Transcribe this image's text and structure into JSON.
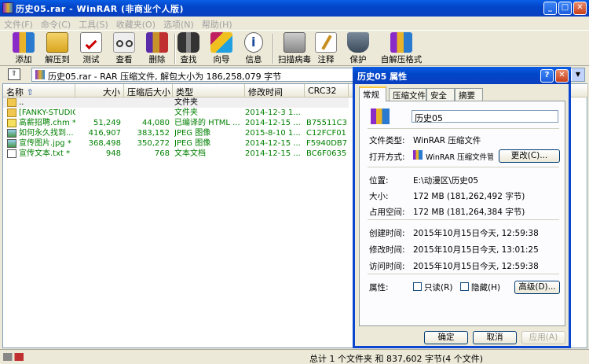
{
  "window": {
    "title": "历史05.rar - WinRAR (非商业个人版)",
    "min": "_",
    "max": "□",
    "close": "✕"
  },
  "menu": [
    "文件(F)",
    "命令(C)",
    "工具(S)",
    "收藏夹(O)",
    "选项(N)",
    "帮助(H)"
  ],
  "toolbar": [
    {
      "label": "添加",
      "icon": "add-books-icon"
    },
    {
      "label": "解压到",
      "icon": "extract-folder-icon"
    },
    {
      "label": "测试",
      "icon": "test-clipboard-icon"
    },
    {
      "label": "查看",
      "icon": "view-glasses-icon"
    },
    {
      "label": "删除",
      "icon": "delete-box-icon"
    },
    {
      "label": "查找",
      "icon": "find-binoculars-icon"
    },
    {
      "label": "向导",
      "icon": "wizard-wand-icon"
    },
    {
      "label": "信息",
      "icon": "info-icon"
    },
    {
      "label": "扫描病毒",
      "icon": "virus-scan-icon"
    },
    {
      "label": "注释",
      "icon": "comment-pen-icon"
    },
    {
      "label": "保护",
      "icon": "shield-icon"
    },
    {
      "label": "自解压格式",
      "icon": "sfx-books-icon"
    }
  ],
  "address": {
    "text": "历史05.rar - RAR 压缩文件, 解包大小为 186,258,079 字节",
    "up": "⇧",
    "drop": "▼"
  },
  "columns": {
    "name": "名称",
    "size": "大小",
    "packed": "压缩后大小",
    "type": "类型",
    "modified": "修改时间",
    "crc": "CRC32",
    "sort_arrow": "⇧"
  },
  "files": [
    {
      "name": "..",
      "size": "",
      "packed": "",
      "type": "文件夹",
      "modified": "",
      "crc": "",
      "kind": "folder"
    },
    {
      "name": "[FANKY-STUDIO...",
      "size": "",
      "packed": "",
      "type": "文件夹",
      "modified": "2014-12-3 1...",
      "crc": "",
      "kind": "folder"
    },
    {
      "name": "高薪招聘.chm *",
      "size": "51,249",
      "packed": "44,080",
      "type": "已编译的 HTML ...",
      "modified": "2014-12-15 ...",
      "crc": "B75511C3",
      "kind": "chm"
    },
    {
      "name": "如何永久找到...",
      "size": "416,907",
      "packed": "383,152",
      "type": "JPEG 图像",
      "modified": "2015-8-10 1...",
      "crc": "C12FCF01",
      "kind": "jpg"
    },
    {
      "name": "宣传图片.jpg *",
      "size": "368,498",
      "packed": "350,272",
      "type": "JPEG 图像",
      "modified": "2014-12-15 ...",
      "crc": "F5940DB7",
      "kind": "jpg"
    },
    {
      "name": "宣传文本.txt *",
      "size": "948",
      "packed": "768",
      "type": "文本文档",
      "modified": "2014-12-15 ...",
      "crc": "BC6F0635",
      "kind": "txt"
    }
  ],
  "status": "总计 1 个文件夹 和 837,602 字节(4 个文件)",
  "dialog": {
    "title": "历史05 属性",
    "help": "?",
    "close": "✕",
    "tabs": [
      "常规",
      "压缩文件",
      "安全",
      "摘要"
    ],
    "name_value": "历史05",
    "labels": {
      "file_type": "文件类型:",
      "open_with": "打开方式:",
      "location": "位置:",
      "size": "大小:",
      "size_on_disk": "占用空间:",
      "created": "创建时间:",
      "modified": "修改时间:",
      "accessed": "访问时间:",
      "attributes": "属性:"
    },
    "values": {
      "file_type": "WinRAR 压缩文件",
      "open_with": "WinRAR 压缩文件管理",
      "location": "E:\\动漫区\\历史05",
      "size": "172 MB (181,262,492 字节)",
      "size_on_disk": "172 MB (181,264,384 字节)",
      "created": "2015年10月15日今天, 12:59:38",
      "modified": "2015年10月15日今天, 13:01:25",
      "accessed": "2015年10月15日今天, 12:59:38"
    },
    "buttons": {
      "change": "更改(C)...",
      "readonly": "只读(R)",
      "hidden": "隐藏(H)",
      "advanced": "高级(D)...",
      "ok": "确定",
      "cancel": "取消",
      "apply": "应用(A)"
    }
  }
}
